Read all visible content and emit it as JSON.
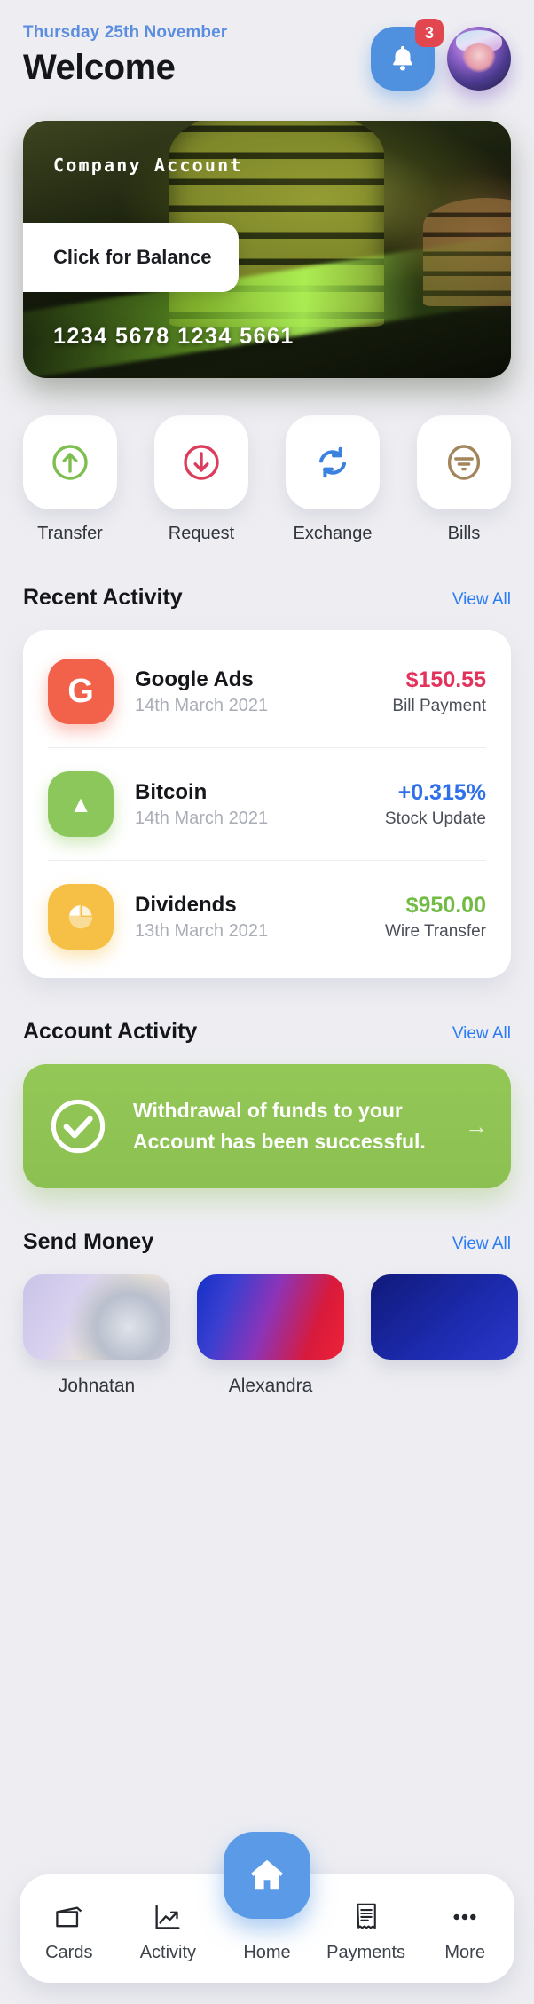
{
  "header": {
    "date": "Thursday 25th November",
    "title": "Welcome",
    "notification_count": "3",
    "bell_icon": "bell-icon",
    "avatar_icon": "user-avatar"
  },
  "card": {
    "account_label": "Company  Account",
    "balance_button": "Click for Balance",
    "number": "1234  5678  1234  5661"
  },
  "quick_actions": [
    {
      "label": "Transfer",
      "icon": "arrow-up-circle-icon",
      "color": "#7cbf4f"
    },
    {
      "label": "Request",
      "icon": "arrow-down-circle-icon",
      "color": "#db3e5c"
    },
    {
      "label": "Exchange",
      "icon": "refresh-exchange-icon",
      "color": "#3b82e0"
    },
    {
      "label": "Bills",
      "icon": "bills-filter-circle-icon",
      "color": "#a3855c"
    }
  ],
  "recent_activity": {
    "title": "Recent Activity",
    "view_all": "View All",
    "items": [
      {
        "name": "Google Ads",
        "date": "14th March 2021",
        "amount": "$150.55",
        "type": "Bill Payment",
        "amount_color": "#e2335c",
        "icon": "google-g-icon",
        "icon_bg": "#f2614a",
        "glyph": "G"
      },
      {
        "name": "Bitcoin",
        "date": "14th March 2021",
        "amount": "+0.315%",
        "type": "Stock Update",
        "amount_color": "#2f6fe8",
        "icon": "triangle-up-icon",
        "icon_bg": "#8cc75c",
        "glyph": "▲"
      },
      {
        "name": "Dividends",
        "date": "13th March 2021",
        "amount": "$950.00",
        "type": "Wire Transfer",
        "amount_color": "#72bb45",
        "icon": "pie-chart-icon",
        "icon_bg": "#f6bf45",
        "glyph": "◔"
      }
    ]
  },
  "account_activity": {
    "title": "Account Activity",
    "view_all": "View All",
    "banner": {
      "line1": "Withdrawal of funds to your",
      "line2": "Account has been successful.",
      "icon": "check-circle-icon",
      "arrow_icon": "arrow-right-icon",
      "arrow": "→",
      "color": "#8cc052"
    }
  },
  "send_money": {
    "title": "Send Money",
    "view_all": "View All",
    "contacts": [
      {
        "name": "Johnatan",
        "image": "money-bills-photo"
      },
      {
        "name": "Alexandra",
        "image": "woman-neon-photo"
      },
      {
        "name": "",
        "image": "blue-photo"
      }
    ]
  },
  "bottom_nav": {
    "items": [
      {
        "label": "Cards",
        "icon": "wallet-icon"
      },
      {
        "label": "Activity",
        "icon": "trending-chart-icon"
      },
      {
        "label": "Home",
        "icon": "home-icon",
        "active": true
      },
      {
        "label": "Payments",
        "icon": "receipt-icon"
      },
      {
        "label": "More",
        "icon": "ellipsis-icon"
      }
    ]
  }
}
